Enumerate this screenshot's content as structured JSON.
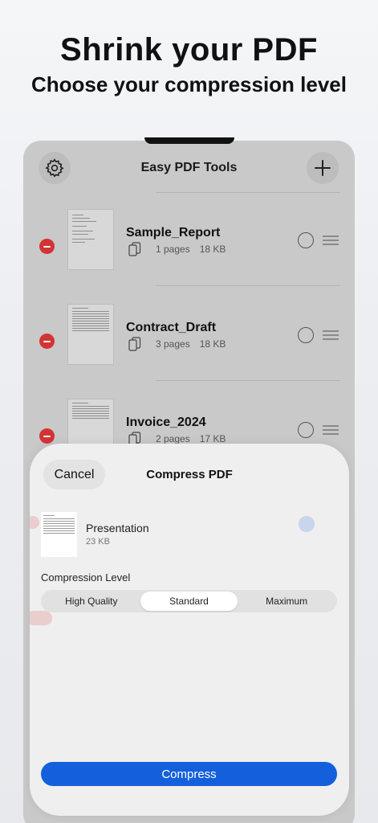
{
  "promo": {
    "headline": "Shrink your PDF",
    "subhead": "Choose your compression level"
  },
  "app": {
    "title": "Easy PDF Tools",
    "settings_icon": "gear-icon",
    "add_icon": "plus-icon"
  },
  "files": [
    {
      "name": "Sample_Report",
      "pages": "1 pages",
      "size": "18 KB"
    },
    {
      "name": "Contract_Draft",
      "pages": "3 pages",
      "size": "18 KB"
    },
    {
      "name": "Invoice_2024",
      "pages": "2 pages",
      "size": "17 KB"
    }
  ],
  "sheet": {
    "cancel_label": "Cancel",
    "title": "Compress PDF",
    "file_name": "Presentation",
    "file_size": "23 KB",
    "level_label": "Compression Level",
    "options": [
      "High Quality",
      "Standard",
      "Maximum"
    ],
    "selected_option": "Standard",
    "compress_label": "Compress"
  },
  "colors": {
    "accent": "#1460dc",
    "delete": "#d23434"
  }
}
